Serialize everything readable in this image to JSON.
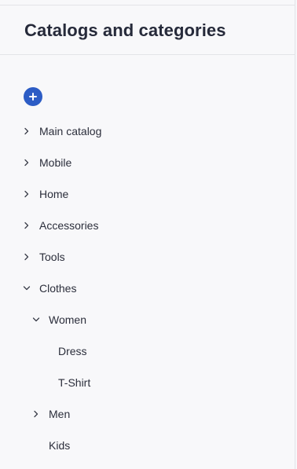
{
  "panel": {
    "title": "Catalogs and categories",
    "add_button_icon": "plus-icon",
    "accent_color": "#2c5cc5"
  },
  "tree": {
    "items": [
      {
        "label": "Main catalog",
        "level": 0,
        "state": "collapsed"
      },
      {
        "label": "Mobile",
        "level": 0,
        "state": "collapsed"
      },
      {
        "label": "Home",
        "level": 0,
        "state": "collapsed"
      },
      {
        "label": "Accessories",
        "level": 0,
        "state": "collapsed"
      },
      {
        "label": "Tools",
        "level": 0,
        "state": "collapsed"
      },
      {
        "label": "Clothes",
        "level": 0,
        "state": "expanded"
      },
      {
        "label": "Women",
        "level": 1,
        "state": "expanded"
      },
      {
        "label": "Dress",
        "level": 2,
        "state": "leaf"
      },
      {
        "label": "T-Shirt",
        "level": 2,
        "state": "leaf"
      },
      {
        "label": "Men",
        "level": 1,
        "state": "collapsed"
      },
      {
        "label": "Kids",
        "level": 1,
        "state": "leaf"
      }
    ]
  }
}
